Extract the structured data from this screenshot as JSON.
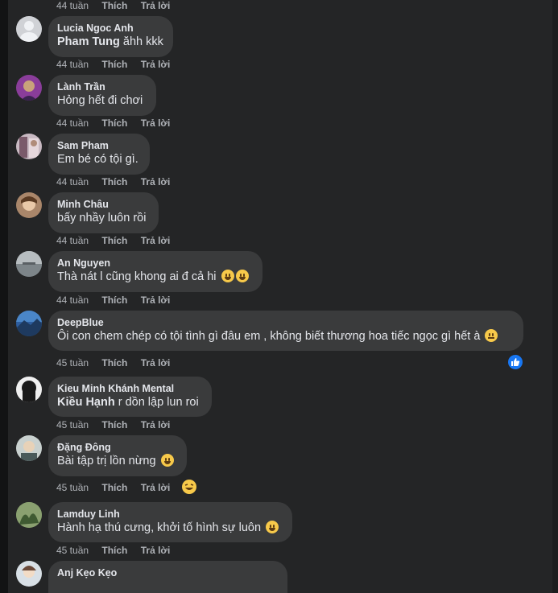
{
  "top_row": {
    "time": "44 tuần",
    "like": "Thích",
    "reply": "Trả lời"
  },
  "comments": [
    {
      "author": "Lucia Ngoc Anh",
      "mention": "Pham Tung",
      "text": " ăhh kkk",
      "time": "44 tuần",
      "like": "Thích",
      "reply": "Trả lời",
      "avatar_color": "#d0d2d6"
    },
    {
      "author": "Lành Trần",
      "text": "Hỏng hết đi chơi",
      "time": "44 tuần",
      "like": "Thích",
      "reply": "Trả lời",
      "avatar_color": "#8a3d9a"
    },
    {
      "author": "Sam Pham",
      "text": "Em bé có tội gì.",
      "time": "44 tuần",
      "like": "Thích",
      "reply": "Trả lời",
      "avatar_color": "#c8b9c2"
    },
    {
      "author": "Minh Châu",
      "text": "bấy nhầy luôn rồi",
      "time": "44 tuần",
      "like": "Thích",
      "reply": "Trả lời",
      "avatar_color": "#a9866a"
    },
    {
      "author": "An Nguyen",
      "text": "Thà nát l cũng khong ai đ cả hi",
      "time": "44 tuần",
      "like": "Thích",
      "reply": "Trả lời",
      "avatar_color": "#9aa2a6"
    },
    {
      "author": "DeepBlue",
      "text": "Ôi con chem chép có tội tình gì đâu em , không biết thương hoa tiếc ngọc gì hết à",
      "time": "45 tuần",
      "like": "Thích",
      "reply": "Trả lời",
      "avatar_color": "#2d5d9e"
    },
    {
      "author": "Kieu Minh Khánh Mental",
      "mention": "Kiều Hạnh",
      "text": " r dồn lập lun roi",
      "time": "45 tuần",
      "like": "Thích",
      "reply": "Trả lời",
      "avatar_color": "#1a1a1a"
    },
    {
      "author": "Đặng Đông",
      "text": "Bài tập trị lồn nừng",
      "time": "45 tuần",
      "like": "Thích",
      "reply": "Trả lời",
      "avatar_color": "#c9d1cf"
    },
    {
      "author": "Lamduy Linh",
      "text": "Hành hạ thú cưng, khởi tố hình sự luôn",
      "time": "45 tuần",
      "like": "Thích",
      "reply": "Trả lời",
      "avatar_color": "#5a7a4a"
    },
    {
      "author": "Anj Kẹo Kẹo",
      "avatar_color": "#d8e0e6"
    }
  ]
}
